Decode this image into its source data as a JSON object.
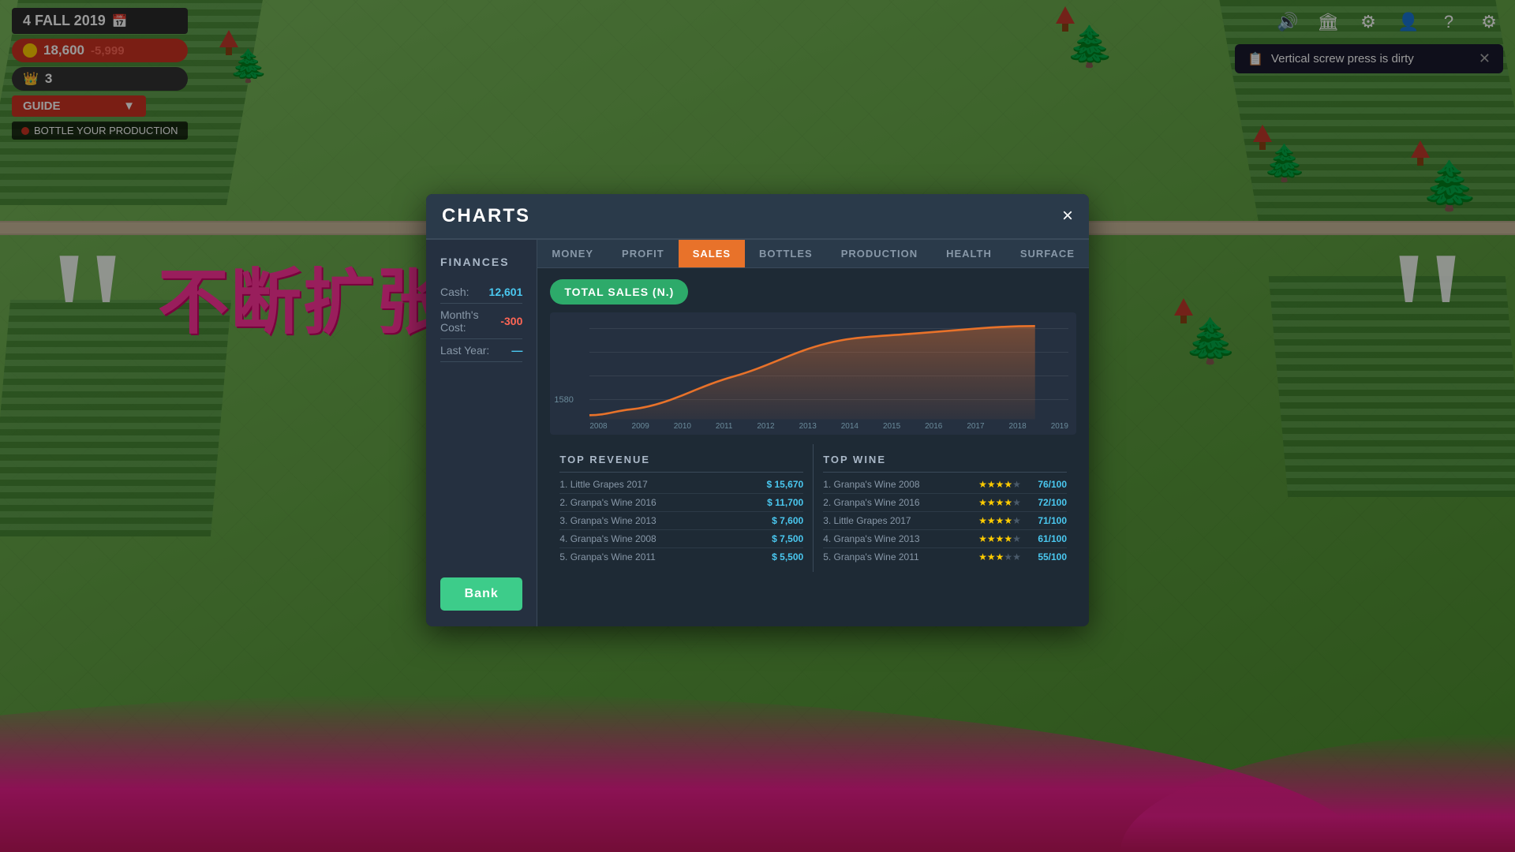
{
  "game": {
    "date": "4 FALL 2019",
    "money": "18,600",
    "money_change": "-5,999",
    "crown_count": "3"
  },
  "hud": {
    "guide_label": "GUIDE",
    "bottle_guide": "BOTTLE YOUR PRODUCTION",
    "notification": "Vertical screw press is dirty",
    "icons": {
      "sound": "🔊",
      "factory": "🏭",
      "settings": "⚙",
      "person": "👤",
      "help": "?",
      "gear": "⚙"
    }
  },
  "modal": {
    "title": "CHARTS",
    "close_label": "×"
  },
  "finances": {
    "title": "FINANCES",
    "cash_label": "Cash:",
    "cash_value": "12,601",
    "month_cost_label": "Month's Cost:",
    "month_cost_value": "-300",
    "last_year_label": "Last Year:",
    "last_year_value": "—",
    "bank_label": "Bank"
  },
  "chart_tabs": [
    {
      "id": "money",
      "label": "MONEY",
      "active": false
    },
    {
      "id": "profit",
      "label": "PROFIT",
      "active": false
    },
    {
      "id": "sales",
      "label": "SALES",
      "active": true
    },
    {
      "id": "bottles",
      "label": "BOTTLES",
      "active": false
    },
    {
      "id": "production",
      "label": "PRODUCTION",
      "active": false
    },
    {
      "id": "health",
      "label": "HEALTH",
      "active": false
    },
    {
      "id": "surface",
      "label": "SURFACE",
      "active": false
    }
  ],
  "chart": {
    "type_label": "TOTAL SALES (N.)",
    "y_labels": [
      "1580"
    ],
    "x_labels": [
      "2008",
      "2009",
      "2010",
      "2011",
      "2012",
      "2013",
      "2014",
      "2015",
      "2016",
      "2017",
      "2018",
      "2019"
    ],
    "data": [
      5,
      8,
      12,
      18,
      22,
      28,
      35,
      40,
      55,
      65,
      70,
      75
    ]
  },
  "top_revenue": {
    "header": "TOP REVENUE",
    "rows": [
      {
        "rank": "1.",
        "name": "Little Grapes 2017",
        "value": "$ 15,670"
      },
      {
        "rank": "2.",
        "name": "Granpa's Wine 2016",
        "value": "$ 11,700"
      },
      {
        "rank": "3.",
        "name": "Granpa's Wine 2013",
        "value": "$ 7,600"
      },
      {
        "rank": "4.",
        "name": "Granpa's Wine 2008",
        "value": "$ 7,500"
      },
      {
        "rank": "5.",
        "name": "Granpa's Wine 2011",
        "value": "$ 5,500"
      }
    ]
  },
  "top_wine": {
    "header": "TOP WINE",
    "rows": [
      {
        "rank": "1.",
        "name": "Granpa's Wine 2008",
        "stars": 4,
        "score": "76/100"
      },
      {
        "rank": "2.",
        "name": "Granpa's Wine 2016",
        "stars": 4,
        "score": "72/100"
      },
      {
        "rank": "3.",
        "name": "Little Grapes 2017",
        "stars": 4,
        "score": "71/100"
      },
      {
        "rank": "4.",
        "name": "Granpa's Wine 2013",
        "stars": 4,
        "score": "61/100"
      },
      {
        "rank": "5.",
        "name": "Granpa's Wine 2011",
        "stars": 3,
        "score": "55/100"
      }
    ]
  },
  "overlay_text": "不断扩张小小的庄园"
}
